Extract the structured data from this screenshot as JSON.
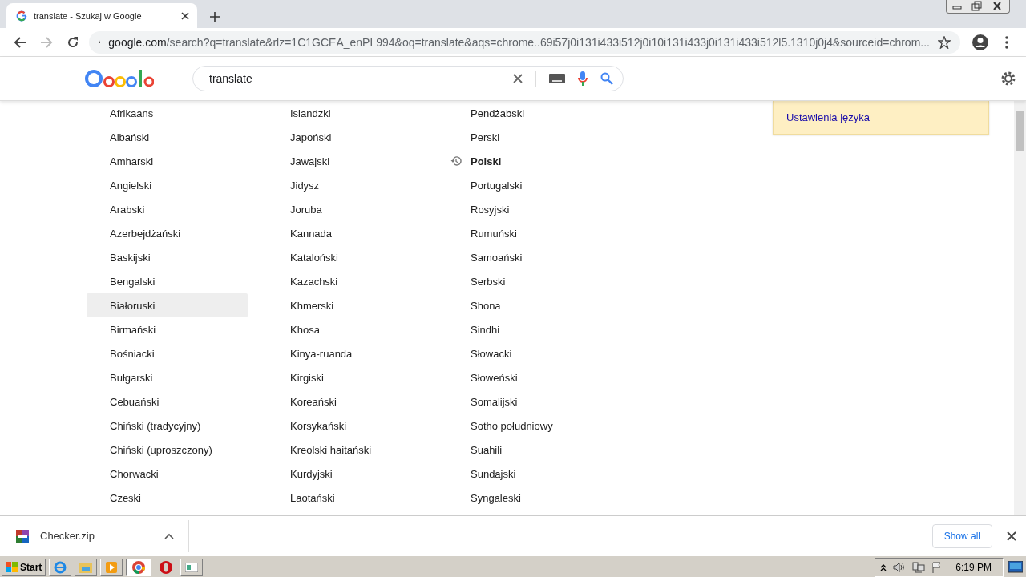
{
  "tab": {
    "title": "translate - Szukaj w Google"
  },
  "toolbar": {
    "url_host": "google.com",
    "url_path": "/search?q=translate&rlz=1C1GCEA_enPL994&oq=translate&aqs=chrome..69i57j0i131i433i512j0i10i131i433j0i131i433i512l5.1310j0j4&sourceid=chrom..."
  },
  "search": {
    "value": "translate"
  },
  "languages": [
    [
      {
        "label": "Afrikaans",
        "selected": false,
        "recent": false
      },
      {
        "label": "Albański",
        "selected": false,
        "recent": false
      },
      {
        "label": "Amharski",
        "selected": false,
        "recent": false
      },
      {
        "label": "Angielski",
        "selected": false,
        "recent": false
      },
      {
        "label": "Arabski",
        "selected": false,
        "recent": false
      },
      {
        "label": "Azerbejdżański",
        "selected": false,
        "recent": false
      },
      {
        "label": "Baskijski",
        "selected": false,
        "recent": false
      },
      {
        "label": "Bengalski",
        "selected": false,
        "recent": false
      },
      {
        "label": "Białoruski",
        "selected": true,
        "recent": false
      },
      {
        "label": "Birmański",
        "selected": false,
        "recent": false
      },
      {
        "label": "Bośniacki",
        "selected": false,
        "recent": false
      },
      {
        "label": "Bułgarski",
        "selected": false,
        "recent": false
      },
      {
        "label": "Cebuański",
        "selected": false,
        "recent": false
      },
      {
        "label": "Chiński (tradycyjny)",
        "selected": false,
        "recent": false
      },
      {
        "label": "Chiński (uproszczony)",
        "selected": false,
        "recent": false
      },
      {
        "label": "Chorwacki",
        "selected": false,
        "recent": false
      },
      {
        "label": "Czeski",
        "selected": false,
        "recent": false
      }
    ],
    [
      {
        "label": "Islandzki",
        "selected": false,
        "recent": false
      },
      {
        "label": "Japoński",
        "selected": false,
        "recent": false
      },
      {
        "label": "Jawajski",
        "selected": false,
        "recent": false
      },
      {
        "label": "Jidysz",
        "selected": false,
        "recent": false
      },
      {
        "label": "Joruba",
        "selected": false,
        "recent": false
      },
      {
        "label": "Kannada",
        "selected": false,
        "recent": false
      },
      {
        "label": "Kataloński",
        "selected": false,
        "recent": false
      },
      {
        "label": "Kazachski",
        "selected": false,
        "recent": false
      },
      {
        "label": "Khmerski",
        "selected": false,
        "recent": false
      },
      {
        "label": "Khosa",
        "selected": false,
        "recent": false
      },
      {
        "label": "Kinya-ruanda",
        "selected": false,
        "recent": false
      },
      {
        "label": "Kirgiski",
        "selected": false,
        "recent": false
      },
      {
        "label": "Koreański",
        "selected": false,
        "recent": false
      },
      {
        "label": "Korsykański",
        "selected": false,
        "recent": false
      },
      {
        "label": "Kreolski haitański",
        "selected": false,
        "recent": false
      },
      {
        "label": "Kurdyjski",
        "selected": false,
        "recent": false
      },
      {
        "label": "Laotański",
        "selected": false,
        "recent": false
      }
    ],
    [
      {
        "label": "Pendżabski",
        "selected": false,
        "recent": false
      },
      {
        "label": "Perski",
        "selected": false,
        "recent": false
      },
      {
        "label": "Polski",
        "selected": false,
        "recent": true
      },
      {
        "label": "Portugalski",
        "selected": false,
        "recent": false
      },
      {
        "label": "Rosyjski",
        "selected": false,
        "recent": false
      },
      {
        "label": "Rumuński",
        "selected": false,
        "recent": false
      },
      {
        "label": "Samoański",
        "selected": false,
        "recent": false
      },
      {
        "label": "Serbski",
        "selected": false,
        "recent": false
      },
      {
        "label": "Shona",
        "selected": false,
        "recent": false
      },
      {
        "label": "Sindhi",
        "selected": false,
        "recent": false
      },
      {
        "label": "Słowacki",
        "selected": false,
        "recent": false
      },
      {
        "label": "Słoweński",
        "selected": false,
        "recent": false
      },
      {
        "label": "Somalijski",
        "selected": false,
        "recent": false
      },
      {
        "label": "Sotho południowy",
        "selected": false,
        "recent": false
      },
      {
        "label": "Suahili",
        "selected": false,
        "recent": false
      },
      {
        "label": "Sundajski",
        "selected": false,
        "recent": false
      },
      {
        "label": "Syngaleski",
        "selected": false,
        "recent": false
      }
    ]
  ],
  "settings_link": "Ustawienia języka",
  "download": {
    "file": "Checker.zip",
    "show_all": "Show all"
  },
  "taskbar": {
    "start": "Start",
    "time": "6:19 PM"
  }
}
